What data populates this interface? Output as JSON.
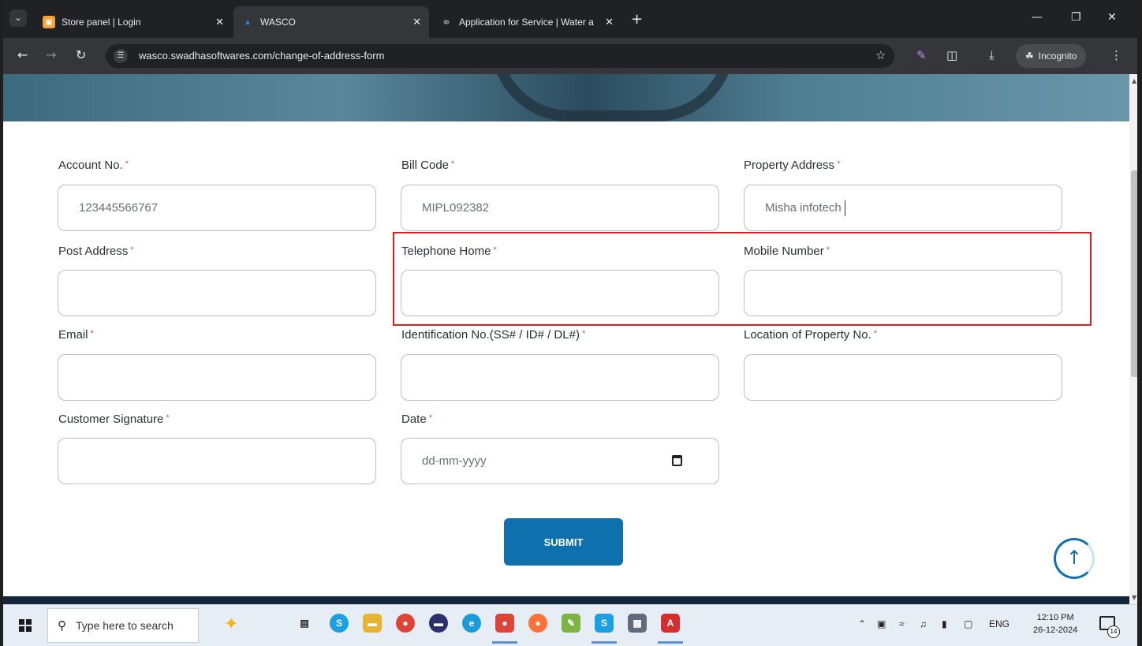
{
  "browser": {
    "tabs": [
      {
        "title": "Store panel | Login",
        "favicon": "store-icon",
        "color": "#f2a33a"
      },
      {
        "title": "WASCO",
        "favicon": "water-drop-icon",
        "color": "#1e88e5"
      },
      {
        "title": "Application for Service | Water a",
        "favicon": "globe-icon",
        "color": "#9aa0a6"
      }
    ],
    "url": "wasco.swadhasoftwares.com/change-of-address-form",
    "incognito_label": "Incognito"
  },
  "form": {
    "fields": [
      {
        "label": "Account No.",
        "required": "*",
        "value": "123445566767"
      },
      {
        "label": "Bill Code",
        "required": "*",
        "value": "MIPL092382"
      },
      {
        "label": "Property Address",
        "required": "*",
        "value": "Misha infotech"
      },
      {
        "label": "Post Address",
        "required": "*",
        "value": ""
      },
      {
        "label": "Telephone Home",
        "required": "*",
        "value": ""
      },
      {
        "label": "Mobile Number",
        "required": "*",
        "value": ""
      },
      {
        "label": "Email",
        "required": "*",
        "value": ""
      },
      {
        "label": "Identification No.(SS# / ID# / DL#)",
        "required": "*",
        "value": ""
      },
      {
        "label": "Location of Property No.",
        "required": "*",
        "value": ""
      },
      {
        "label": "Customer Signature",
        "required": "*",
        "value": ""
      },
      {
        "label": "Date",
        "required": "*",
        "value": "dd-mm-yyyy"
      }
    ],
    "submit_label": "SUBMIT"
  },
  "taskbar": {
    "search_placeholder": "Type here to search",
    "language": "ENG",
    "time": "12:10 PM",
    "date": "26-12-2024",
    "notification_count": "14"
  },
  "colors": {
    "accent": "#0e71ad",
    "required": "#d9534f",
    "highlight": "#e01e1e"
  }
}
